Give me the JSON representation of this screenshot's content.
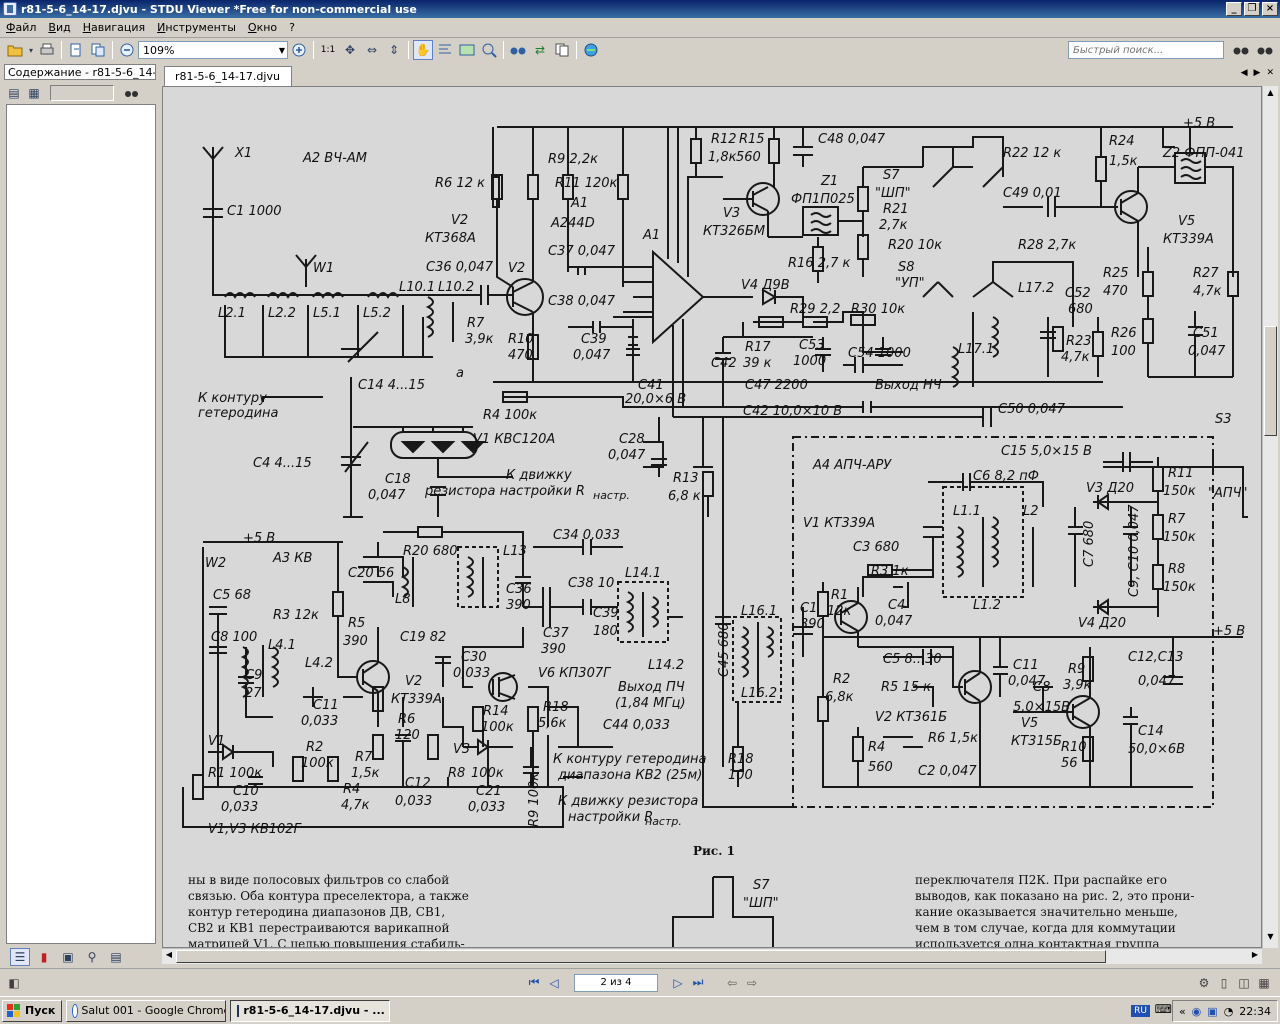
{
  "window": {
    "title": "r81-5-6_14-17.djvu - STDU Viewer *Free for non-commercial use"
  },
  "menu": [
    "Файл",
    "Вид",
    "Навигация",
    "Инструменты",
    "Окно",
    "?"
  ],
  "toolbar": {
    "zoom": "109%",
    "page_fit_label": "1:1",
    "search_placeholder": "Быстрый поиск..."
  },
  "sidebar": {
    "tab_label": "Содержание - r81-5-6_14-17"
  },
  "document": {
    "tab_label": "r81-5-6_14-17.djvu"
  },
  "navigation": {
    "page_indicator": "2 из 4"
  },
  "taskbar": {
    "start": "Пуск",
    "buttons": [
      "Salut 001 - Google Chrome",
      "r81-5-6_14-17.djvu - ..."
    ],
    "lang": "RU",
    "clock": "22:34"
  },
  "schematic": {
    "blocks": {
      "a2": "A2   ВЧ-АМ",
      "a3": "A3   КВ",
      "a4": "A4   АПЧ-АРУ",
      "fig": "Рис. 1"
    },
    "labels": {
      "x1": "X1",
      "c1": "C1 1000",
      "w1": "W1",
      "l21": "L2.1",
      "l22": "L2.2",
      "l51": "L5.1",
      "l52": "L5.2",
      "l101": "L10.1",
      "l102": "L10.2",
      "c14": "C14  4...15",
      "c4": "C4  4...15",
      "k_kontur1": "К контуру",
      "k_kontur2": "гетеродина",
      "r4": "R4 100к",
      "v1": "V1  КВС120А",
      "c18a": "C18",
      "c18b": "0,047",
      "k_dv1": "К движку",
      "k_dv2": "резистора настройки R",
      "k_dv_sub": "настр.",
      "c28a": "C28",
      "c28b": "0,047",
      "r6": "R6  12 к",
      "r7a": "R7",
      "r7b": "3,9к",
      "a_lbl": "a",
      "v2t": "V2",
      "v2a": "КТ368А",
      "c36": "C36 0,047",
      "v2l": "V2",
      "r9": "R9  2,2к",
      "r11": "R11 120к",
      "a1a": "A1",
      "a1b": "A244D",
      "c37": "C37 0,047",
      "a1": "A1",
      "c38": "C38 0,047",
      "r10a": "R10",
      "r10b": "470",
      "c39a": "C39",
      "c39b": "0,047",
      "c41a": "C41",
      "c41b": "20,0×6 В",
      "r12a": "R12",
      "r12b": "1,8к",
      "r15a": "R15",
      "r15b": "560",
      "c48": "C48  0,047",
      "v3a": "V3",
      "v3b": "КТ326БМ",
      "z1a": "Z1",
      "z1b": "ФП1П025",
      "r16": "R16   2,7 к",
      "s7": "S7",
      "shp": "\"ШП\"",
      "r21a": "R21",
      "r21b": "2,7к",
      "r20": "R20  10к",
      "s8": "S8",
      "up": "\"УП\"",
      "v4": "V4   Д9В",
      "r17a": "R17",
      "r17b": "39 к",
      "r29": "R29 2,2",
      "r30": "R30  10к",
      "c53a": "C53",
      "c53b": "1000",
      "c54": "C54 1000",
      "c47": "C47  2200",
      "vyh": "Выход НЧ",
      "c42": "C42",
      "c42v": "C42  10,0×10 В",
      "c50": "C50  0,047",
      "r22": "R22  12 к",
      "c49": "C49  0,01",
      "r28": "R28  2,7к",
      "r24a": "R24",
      "r24b": "1,5к",
      "z2": "Z2  ФПП-041",
      "v5a": "V5",
      "v5b": "КТ339А",
      "plus5": "+5 В",
      "l172": "L17.2",
      "l171": "L17.1",
      "c52a": "C52",
      "c52b": "680",
      "r23a": "R23",
      "r23b": "4,7к",
      "r25a": "R25",
      "r25b": "470",
      "r27a": "R27",
      "r27b": "4,7к",
      "r26a": "R26",
      "r26b": "100",
      "c51a": "C51",
      "c51b": "0,047",
      "r13a": "R13",
      "r13b": "6,8 к",
      "s3": "S3",
      "apch": "\"АПЧ\"",
      "c15": "C15 5,0×15 В",
      "v1a4": "V1  КТ339А",
      "c6": "C6   8,2 пФ",
      "r11a4a": "R11",
      "r11a4b": "150к",
      "v3a4": "V3  Д20",
      "r7a4a": "R7",
      "r7a4b": "150к",
      "r8a4a": "R8",
      "r8a4b": "150к",
      "l1": "L1.1",
      "l2": "L2",
      "l12": "L1.2",
      "c7": "C7  680",
      "c9": "C9, C10  0,047",
      "v4a4": "V4   Д20",
      "c3": "C3  680",
      "r3a4": "R3   1к",
      "c4a4a": "C4",
      "c4a4b": "0,047",
      "r1a4a": "R1",
      "r1a4b": "12к",
      "c1a4a": "C1",
      "c1a4b": "390",
      "l161": "L16.1",
      "l162": "L16.2",
      "c45": "C45  680",
      "r18a4a": "R18",
      "r18a4b": "100",
      "r2a4a": "R2",
      "r2a4b": "6,8к",
      "c5a4": "C5  8...30",
      "r5a4": "R5  15 к",
      "v2a4": "V2  КТ361Б",
      "c11a4a": "C11",
      "c11a4b": "0,047",
      "c8a4a": "C8",
      "c8a4b": "5,0×15В",
      "r9a4a": "R9",
      "r9a4b": "3,9к",
      "c1213a": "C12,C13",
      "c1213b": "0,047",
      "v5a4a": "V5",
      "v5a4b": "КТ315Б",
      "r6a4": "R6  1,5к",
      "r4a4a": "R4",
      "r4a4b": "560",
      "c2a4": "C2  0,047",
      "r10a4a": "R10",
      "r10a4b": "56",
      "c14a4a": "C14",
      "c14a4b": "50,0×6В",
      "plus5b": "+5 В",
      "w2": "W2",
      "c5a3": "C5  68",
      "c8a3": "C8  100",
      "l41": "L4.1",
      "l42": "L4.2",
      "c9a3a": "C9",
      "c9a3b": "27",
      "c11a3a": "C11",
      "c11a3b": "0,033",
      "r3a3": "R3  12к",
      "c20": "C20  56",
      "r20a3": "R20  680",
      "l13": "L13",
      "l8": "L8",
      "r5a3a": "R5",
      "r5a3b": "390",
      "c19": "C19  82",
      "c34": "C34  0,033",
      "c36a3a": "C36",
      "c36a3b": "390",
      "c38a3": "C38  10",
      "l141": "L14.1",
      "c37a3a": "C37",
      "c37a3b": "390",
      "c39a3a": "C39",
      "c39a3b": "180",
      "v2a3a": "V2",
      "v2a3b": "КТ339А",
      "r6a3a": "R6",
      "r6a3b": "120",
      "c30a": "C30",
      "c30b": "0,033",
      "v6": "V6  КП307Г",
      "l142": "L14.2",
      "vyhpch1": "Выход ПЧ",
      "vyhpch2": "(1,84 МГц)",
      "c44": "C44  0,033",
      "r14a": "R14",
      "r14b": "100к",
      "r18a3a": "R18",
      "r18a3b": "5,6к",
      "kkont1": "К контуру гетеродина",
      "kkont2": "диапазона КВ2 (25м)",
      "kdv1": "К движку резистора",
      "kdv2": "настройки R",
      "kdv_sub": "настр.",
      "v1a3": "V1",
      "r1a3": "R1  100к",
      "c10a": "C10",
      "c10b": "0,033",
      "r2a3a": "R2",
      "r2a3b": "100к",
      "r7a3a": "R7",
      "r7a3b": "1,5к",
      "r4a3a": "R4",
      "r4a3b": "4,7к",
      "c12a": "C12",
      "c12b": "0,033",
      "v3a3": "V3",
      "r8a3": "R8",
      "r8v": "100к",
      "c21a": "C21",
      "c21b": "0,033",
      "r9a3": "R9  100к",
      "v13": "V1,V3  КВ102Г",
      "s7b": "S7",
      "shpb": "\"ШП\""
    },
    "text_left": [
      "ны в виде полосовых фильтров со слабой",
      "связью. Оба контура преселектора, а также",
      "контур гетеродина диапазонов ДВ, СВ1,",
      "СВ2 и КВ1 перестраиваются варикапной",
      "матрицей V1. С целью повышения стабиль-"
    ],
    "text_right": [
      "переключателя П2К. При распайке его",
      "выводов, как показано на рис. 2, это прони-",
      "кание оказывается значительно меньше,",
      "чем в том случае, когда для коммутации",
      "используется одна контактная группа"
    ]
  }
}
